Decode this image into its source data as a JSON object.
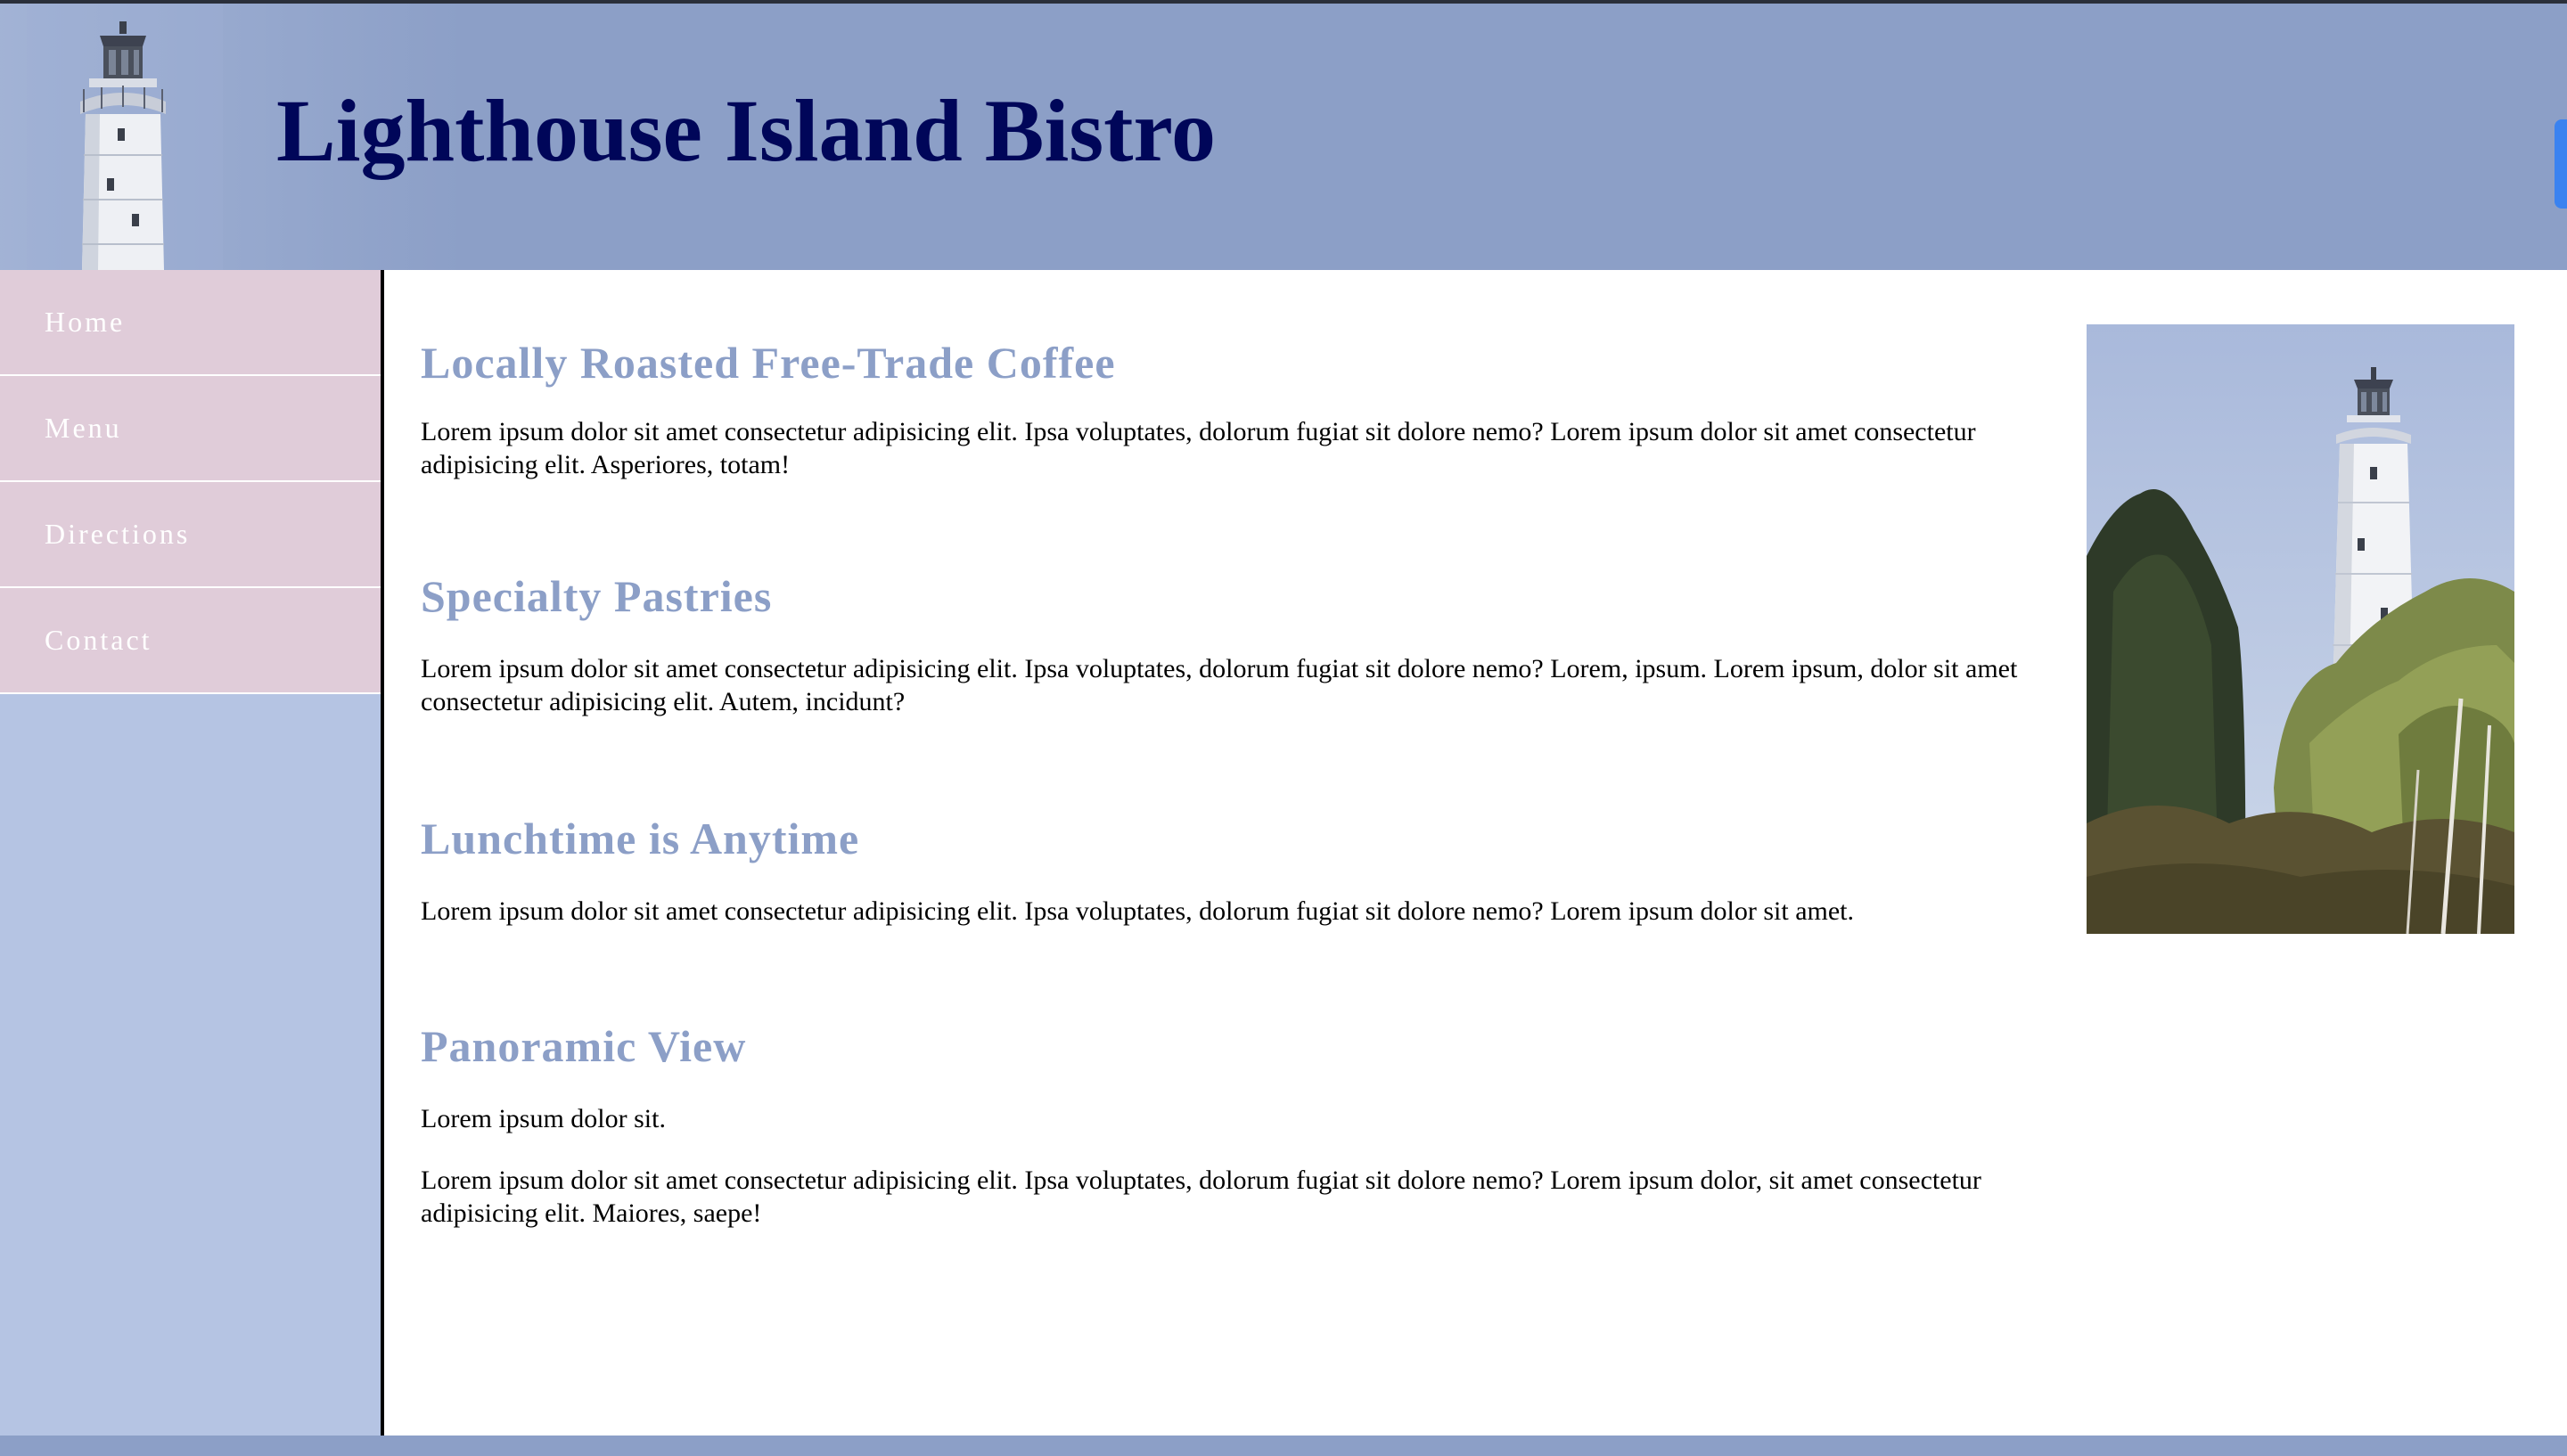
{
  "site": {
    "title": "Lighthouse Island Bistro"
  },
  "nav": {
    "items": [
      {
        "label": "Home"
      },
      {
        "label": "Menu"
      },
      {
        "label": "Directions"
      },
      {
        "label": "Contact"
      }
    ]
  },
  "sections": [
    {
      "heading": "Locally Roasted Free-Trade Coffee",
      "paragraphs": [
        "Lorem ipsum dolor sit amet consectetur adipisicing elit. Ipsa voluptates, dolorum fugiat sit dolore nemo? Lorem ipsum dolor sit amet consectetur adipisicing elit. Asperiores, totam!"
      ]
    },
    {
      "heading": "Specialty Pastries",
      "paragraphs": [
        "Lorem ipsum dolor sit amet consectetur adipisicing elit. Ipsa voluptates, dolorum fugiat sit dolore nemo? Lorem, ipsum. Lorem ipsum, dolor sit amet consectetur adipisicing elit. Autem, incidunt?"
      ]
    },
    {
      "heading": "Lunchtime is Anytime",
      "paragraphs": [
        "Lorem ipsum dolor sit amet consectetur adipisicing elit. Ipsa voluptates, dolorum fugiat sit dolore nemo? Lorem ipsum dolor sit amet."
      ]
    },
    {
      "heading": "Panoramic View",
      "paragraphs": [
        "Lorem ipsum dolor sit.",
        "Lorem ipsum dolor sit amet consectetur adipisicing elit. Ipsa voluptates, dolorum fugiat sit dolore nemo? Lorem ipsum dolor, sit amet consectetur adipisicing elit. Maiores, saepe!"
      ]
    }
  ],
  "colors": {
    "header_bg": "#8c9fc7",
    "title_text": "#000659",
    "heading_text": "#8c9fc7",
    "nav_bg": "#e0ccd9",
    "sidebar_bg": "#b5c4e3"
  },
  "icons": {
    "logo": "lighthouse-image",
    "photo": "lighthouse-photo"
  }
}
